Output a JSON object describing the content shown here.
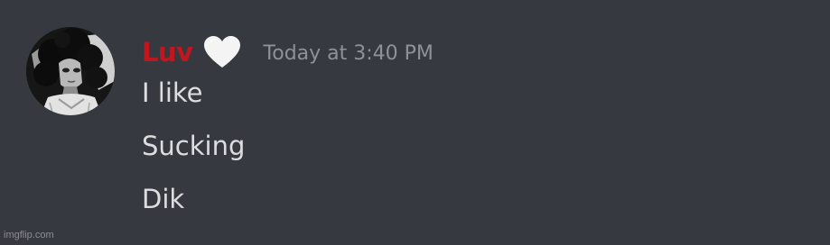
{
  "message": {
    "author": "Luv",
    "author_color": "#c0161f",
    "badge_icon": "white-heart-icon",
    "timestamp": "Today at 3:40 PM",
    "lines": [
      "I like",
      "Sucking",
      "Dik"
    ]
  },
  "theme": {
    "background": "#36393f",
    "text_color": "#dcddde",
    "timestamp_color": "#8e9297"
  },
  "watermark": "imgflip.com"
}
